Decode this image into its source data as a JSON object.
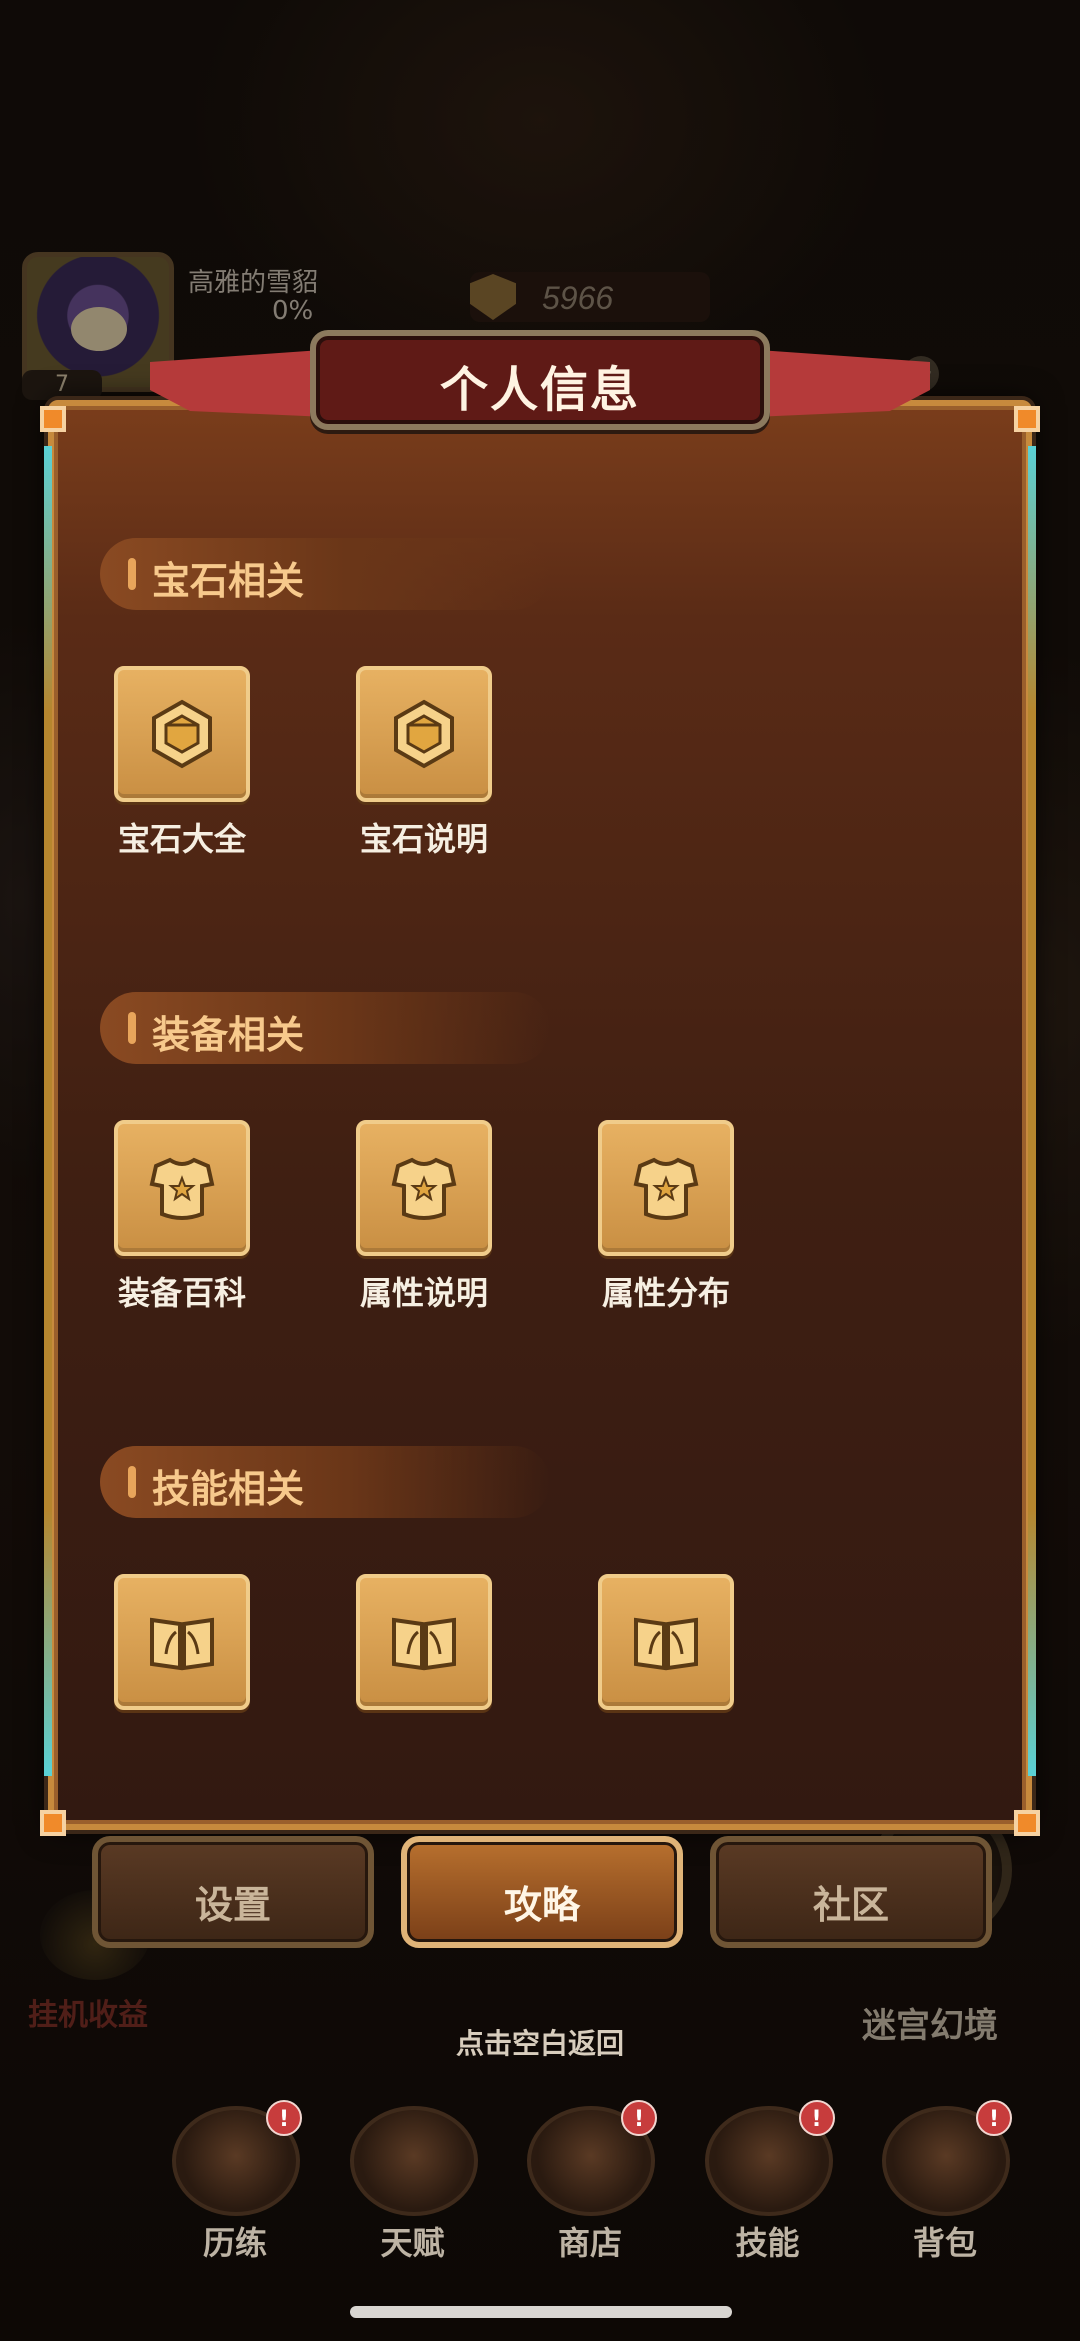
{
  "player": {
    "name": "高雅的雪貂",
    "exp": "0%",
    "level": "7"
  },
  "currency": {
    "gold": "5966"
  },
  "modal": {
    "title": "个人信息",
    "sections": [
      {
        "title": "宝石相关",
        "items": [
          {
            "label": "宝石大全",
            "icon": "gem-icon"
          },
          {
            "label": "宝石说明",
            "icon": "gem-icon"
          }
        ]
      },
      {
        "title": "装备相关",
        "items": [
          {
            "label": "装备百科",
            "icon": "armor-icon"
          },
          {
            "label": "属性说明",
            "icon": "armor-icon"
          },
          {
            "label": "属性分布",
            "icon": "armor-icon"
          }
        ]
      },
      {
        "title": "技能相关",
        "items": [
          {
            "label": "",
            "icon": "book-icon"
          },
          {
            "label": "",
            "icon": "book-icon"
          },
          {
            "label": "",
            "icon": "book-icon"
          }
        ]
      }
    ],
    "tabs": [
      {
        "label": "设置",
        "active": false
      },
      {
        "label": "攻略",
        "active": true
      },
      {
        "label": "社区",
        "active": false
      }
    ],
    "dismiss_hint": "点击空白返回"
  },
  "background": {
    "idle_income_label": "挂机收益",
    "maze_label": "迷宫幻境"
  },
  "bottom_nav": [
    {
      "label": "历练",
      "icon": "training-icon",
      "badge": "!"
    },
    {
      "label": "天赋",
      "icon": "talent-icon",
      "badge": ""
    },
    {
      "label": "商店",
      "icon": "shop-icon",
      "badge": "!"
    },
    {
      "label": "技能",
      "icon": "skill-icon",
      "badge": "!"
    },
    {
      "label": "背包",
      "icon": "bag-icon",
      "badge": "!"
    }
  ],
  "colors": {
    "accent": "#e7b162",
    "title_plate": "#5f1a16",
    "badge": "#c73c3c"
  }
}
